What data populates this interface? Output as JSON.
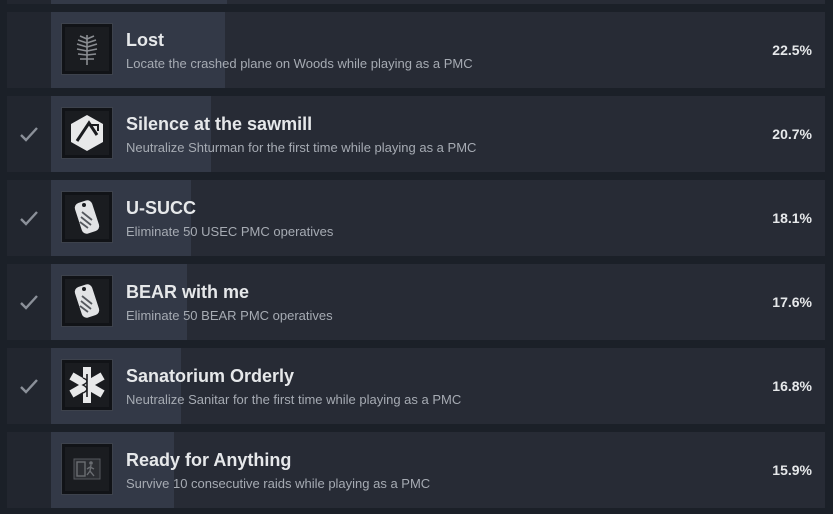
{
  "achievements": [
    {
      "title": "Lost",
      "description": "Locate the crashed plane on Woods while playing as a PMC",
      "percent_label": "22.5%",
      "percent": 22.5,
      "unlocked": false,
      "icon": "fern-icon"
    },
    {
      "title": "Silence at the sawmill",
      "description": "Neutralize Shturman for the first time while playing as a PMC",
      "percent_label": "20.7%",
      "percent": 20.7,
      "unlocked": true,
      "icon": "sawmill-hexagon-icon"
    },
    {
      "title": "U-SUCC",
      "description": "Eliminate 50 USEC PMC operatives",
      "percent_label": "18.1%",
      "percent": 18.1,
      "unlocked": true,
      "icon": "usec-dogtag-icon"
    },
    {
      "title": "BEAR with me",
      "description": "Eliminate 50 BEAR PMC operatives",
      "percent_label": "17.6%",
      "percent": 17.6,
      "unlocked": true,
      "icon": "bear-dogtag-icon"
    },
    {
      "title": "Sanatorium Orderly",
      "description": "Neutralize Sanitar for the first time while playing as a PMC",
      "percent_label": "16.8%",
      "percent": 16.8,
      "unlocked": true,
      "icon": "medical-caduceus-icon"
    },
    {
      "title": "Ready for Anything",
      "description": "Survive 10 consecutive raids while playing as a PMC",
      "percent_label": "15.9%",
      "percent": 15.9,
      "unlocked": false,
      "icon": "exit-sign-icon"
    }
  ]
}
